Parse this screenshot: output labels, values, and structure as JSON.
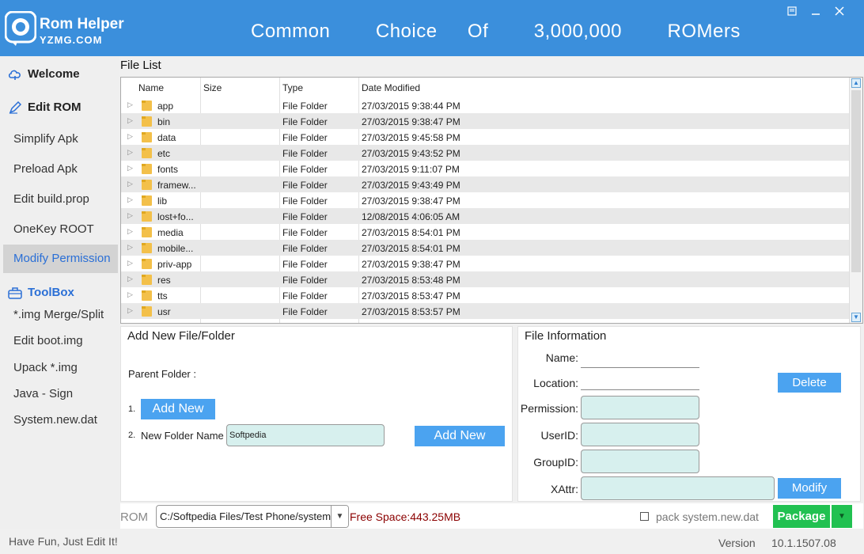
{
  "header": {
    "brand_title": "Rom Helper",
    "brand_sub": "YZMG.COM",
    "slogan": "Common   Choice  Of   3,000,000   ROMers",
    "accent": "#3b8fdc"
  },
  "sidebar": {
    "welcome": "Welcome",
    "edit_rom": "Edit ROM",
    "items": [
      "Simplify Apk",
      "Preload Apk",
      "Edit build.prop",
      "OneKey ROOT",
      "Modify Permission"
    ],
    "active_index": 4,
    "toolbox": "ToolBox",
    "toolbox_items": [
      "*.img Merge/Split",
      "Edit boot.img",
      "Upack  *.img",
      "Java - Sign",
      "System.new.dat"
    ]
  },
  "file_list": {
    "title": "File List",
    "columns": [
      "Name",
      "Size",
      "Type",
      "Date Modified"
    ],
    "rows": [
      {
        "name": "app",
        "size": "",
        "type": "File Folder",
        "date": "27/03/2015 9:38:44 PM"
      },
      {
        "name": "bin",
        "size": "",
        "type": "File Folder",
        "date": "27/03/2015 9:38:47 PM"
      },
      {
        "name": "data",
        "size": "",
        "type": "File Folder",
        "date": "27/03/2015 9:45:58 PM"
      },
      {
        "name": "etc",
        "size": "",
        "type": "File Folder",
        "date": "27/03/2015 9:43:52 PM"
      },
      {
        "name": "fonts",
        "size": "",
        "type": "File Folder",
        "date": "27/03/2015 9:11:07 PM"
      },
      {
        "name": "framew...",
        "size": "",
        "type": "File Folder",
        "date": "27/03/2015 9:43:49 PM"
      },
      {
        "name": "lib",
        "size": "",
        "type": "File Folder",
        "date": "27/03/2015 9:38:47 PM"
      },
      {
        "name": "lost+fo...",
        "size": "",
        "type": "File Folder",
        "date": "12/08/2015 4:06:05 AM"
      },
      {
        "name": "media",
        "size": "",
        "type": "File Folder",
        "date": "27/03/2015 8:54:01 PM"
      },
      {
        "name": "mobile...",
        "size": "",
        "type": "File Folder",
        "date": "27/03/2015 8:54:01 PM"
      },
      {
        "name": "priv-app",
        "size": "",
        "type": "File Folder",
        "date": "27/03/2015 9:38:47 PM"
      },
      {
        "name": "res",
        "size": "",
        "type": "File Folder",
        "date": "27/03/2015 8:53:48 PM"
      },
      {
        "name": "tts",
        "size": "",
        "type": "File Folder",
        "date": "27/03/2015 8:53:47 PM"
      },
      {
        "name": "usr",
        "size": "",
        "type": "File Folder",
        "date": "27/03/2015 8:53:57 PM"
      }
    ]
  },
  "add_panel": {
    "title": "Add New File/Folder",
    "parent_folder_label": "Parent Folder :",
    "step1": "1.",
    "add_file_button": "Add New File",
    "step2": "2.",
    "new_folder_label": "New Folder Name",
    "new_folder_value": "Softpedia",
    "add_folder_button": "Add New Folder"
  },
  "info_panel": {
    "title": "File Information",
    "name_label": "Name:",
    "location_label": "Location:",
    "permission_label": "Permission:",
    "userid_label": "UserID:",
    "groupid_label": "GroupID:",
    "xattr_label": "XAttr:",
    "delete_button": "Delete",
    "modify_button": "Modify"
  },
  "rom_bar": {
    "rom_label": "ROM",
    "rom_path": "C:/Softpedia Files/Test Phone/system.img",
    "free_space": "Free Space:443.25MB",
    "pack_label": "pack system.new.dat",
    "pack_checked": false,
    "package_button": "Package"
  },
  "status": {
    "left": "Have Fun, Just Edit It!",
    "version_label": "Version",
    "version": "10.1.1507.08"
  }
}
